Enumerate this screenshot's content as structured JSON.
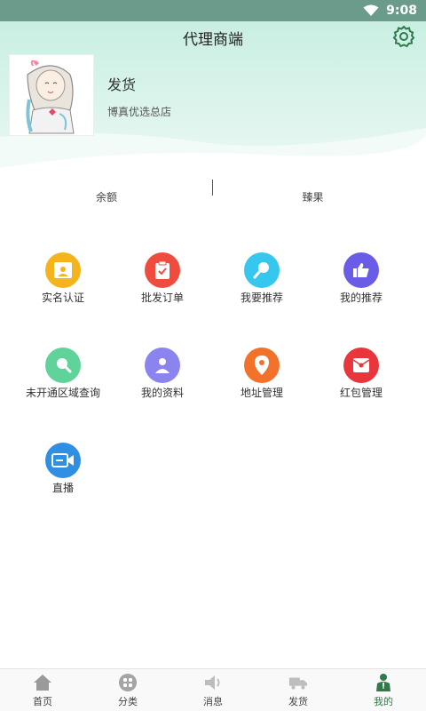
{
  "status": {
    "time": "9:08"
  },
  "header": {
    "title": "代理商端"
  },
  "profile": {
    "name": "发货",
    "store": "博真优选总店"
  },
  "stats": [
    {
      "label": "余额"
    },
    {
      "label": "臻果"
    }
  ],
  "grid": [
    {
      "label": "实名认证",
      "icon": "id-card-icon",
      "color": "#f5b41e"
    },
    {
      "label": "批发订单",
      "icon": "order-clipboard-icon",
      "color": "#ef4b3f"
    },
    {
      "label": "我要推荐",
      "icon": "search-key-icon",
      "color": "#35c7ee"
    },
    {
      "label": "我的推荐",
      "icon": "thumbs-up-icon",
      "color": "#6b5ce7"
    },
    {
      "label": "未开通区域查询",
      "icon": "search-icon",
      "color": "#5fd39a"
    },
    {
      "label": "我的资料",
      "icon": "user-icon",
      "color": "#8b84ee"
    },
    {
      "label": "地址管理",
      "icon": "location-pin-icon",
      "color": "#f2712b"
    },
    {
      "label": "红包管理",
      "icon": "red-envelope-icon",
      "color": "#e8363c"
    },
    {
      "label": "直播",
      "icon": "video-camera-icon",
      "color": "#2f8fe3"
    }
  ],
  "tabs": [
    {
      "label": "首页",
      "icon": "home-icon"
    },
    {
      "label": "分类",
      "icon": "category-icon"
    },
    {
      "label": "消息",
      "icon": "speaker-icon"
    },
    {
      "label": "发货",
      "icon": "truck-icon"
    },
    {
      "label": "我的",
      "icon": "profile-icon",
      "active": true
    }
  ],
  "colors": {
    "accent": "#2f7a4a",
    "header_mint": "#d4f1e8",
    "status_bar": "#6b9b8a"
  }
}
